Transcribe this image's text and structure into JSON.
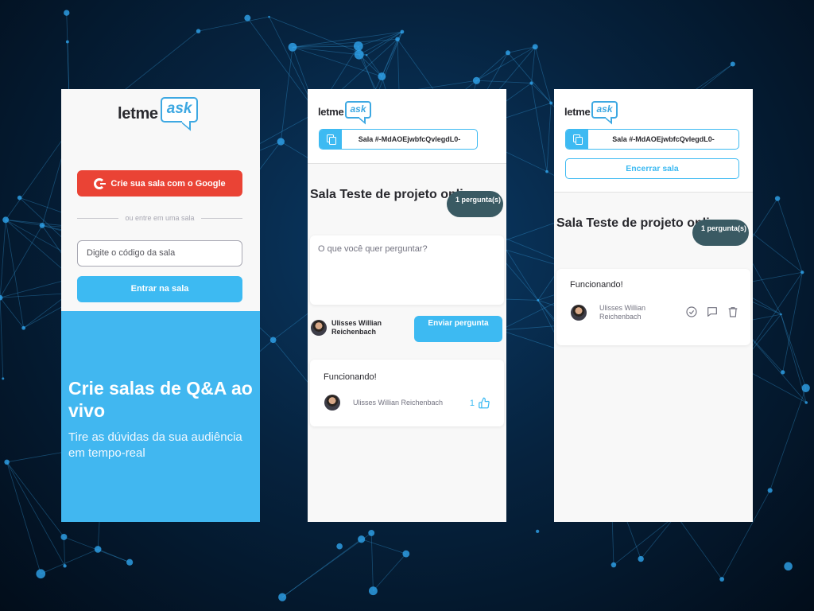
{
  "brand": {
    "logo_word": "letme",
    "logo_accent": "ask"
  },
  "colors": {
    "google": "#ea4335",
    "primary": "#3dbaf2",
    "badge": "#3a5a63",
    "hero": "#41b7f0"
  },
  "home": {
    "google_button": "Crie sua sala com o Google",
    "divider_text": "ou entre em uma sala",
    "code_input_placeholder": "Digite o código da sala",
    "enter_button": "Entrar na sala",
    "hero_title": "Crie salas de Q&A ao vivo",
    "hero_subtitle": "Tire as dúvidas da sua audiência em tempo-real"
  },
  "room": {
    "code_label": "Sala #-MdAOEjwbfcQvlegdL0-",
    "title": "Sala Teste de projeto online",
    "question_count": "1 pergunta(s)",
    "ask_placeholder": "O que você quer perguntar?",
    "user_name": "Ulisses Willian Reichenbach",
    "send_button": "Enviar pergunta",
    "question_content": "Funcionando!",
    "question_author": "Ulisses Willian Reichenbach",
    "like_count": "1"
  },
  "admin": {
    "code_label": "Sala #-MdAOEjwbfcQvlegdL0-",
    "close_button": "Encerrar sala",
    "title": "Sala Teste de projeto online",
    "question_count": "1 pergunta(s)",
    "question_content": "Funcionando!",
    "question_author": "Ulisses Willian Reichenbach",
    "action_icons": [
      "check-circle-icon",
      "answer-bubble-icon",
      "trash-icon"
    ]
  }
}
